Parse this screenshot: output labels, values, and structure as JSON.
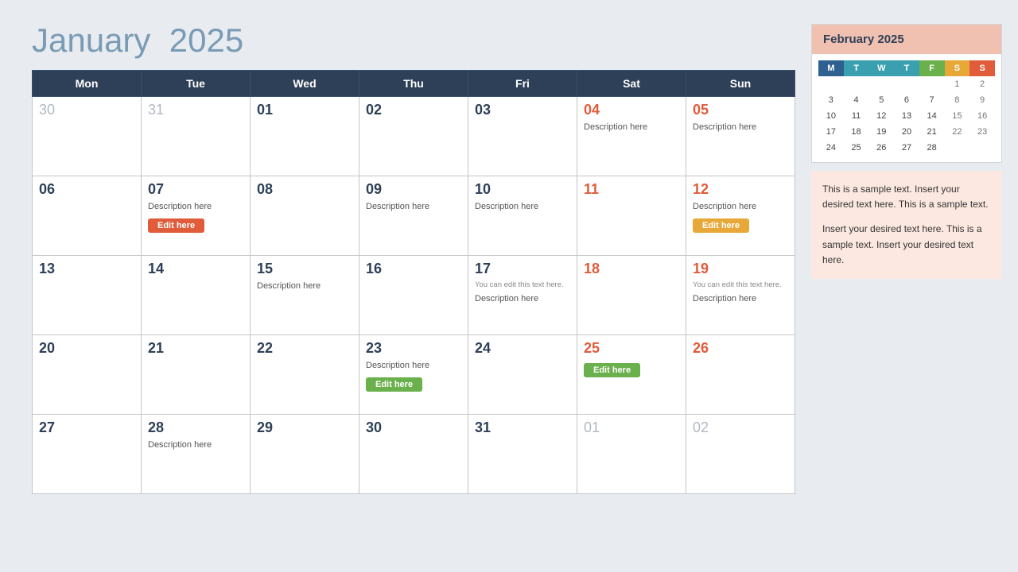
{
  "header": {
    "month": "January",
    "year": "2025"
  },
  "weekdays": [
    "Mon",
    "Tue",
    "Wed",
    "Thu",
    "Fri",
    "Sat",
    "Sun"
  ],
  "weeks": [
    [
      {
        "num": "30",
        "type": "other-month",
        "desc": "",
        "btn": null
      },
      {
        "num": "31",
        "type": "other-month",
        "desc": "",
        "btn": null
      },
      {
        "num": "01",
        "type": "normal",
        "desc": "",
        "btn": null
      },
      {
        "num": "02",
        "type": "normal",
        "desc": "",
        "btn": null
      },
      {
        "num": "03",
        "type": "normal",
        "desc": "",
        "btn": null
      },
      {
        "num": "04",
        "type": "weekend",
        "desc": "Description here",
        "btn": null
      },
      {
        "num": "05",
        "type": "weekend",
        "desc": "Description here",
        "btn": null
      }
    ],
    [
      {
        "num": "06",
        "type": "normal",
        "desc": "",
        "btn": null
      },
      {
        "num": "07",
        "type": "normal",
        "desc": "Description here",
        "btn": {
          "label": "Edit here",
          "color": "red"
        }
      },
      {
        "num": "08",
        "type": "normal",
        "desc": "",
        "btn": null
      },
      {
        "num": "09",
        "type": "normal",
        "desc": "Description here",
        "btn": null
      },
      {
        "num": "10",
        "type": "normal",
        "desc": "Description here",
        "btn": null
      },
      {
        "num": "11",
        "type": "weekend",
        "desc": "",
        "btn": null
      },
      {
        "num": "12",
        "type": "weekend",
        "desc": "Description here",
        "btn": {
          "label": "Edit here",
          "color": "orange"
        }
      }
    ],
    [
      {
        "num": "13",
        "type": "normal",
        "desc": "",
        "btn": null
      },
      {
        "num": "14",
        "type": "normal",
        "desc": "",
        "btn": null
      },
      {
        "num": "15",
        "type": "normal",
        "desc": "Description here",
        "btn": null
      },
      {
        "num": "16",
        "type": "normal",
        "desc": "",
        "btn": null
      },
      {
        "num": "17",
        "type": "normal",
        "desc": "Description here",
        "smallNote": "You can edit this text here.",
        "btn": null
      },
      {
        "num": "18",
        "type": "weekend",
        "desc": "",
        "btn": null
      },
      {
        "num": "19",
        "type": "weekend",
        "desc": "Description here",
        "smallNote": "You can edit this text here.",
        "btn": null
      }
    ],
    [
      {
        "num": "20",
        "type": "normal",
        "desc": "",
        "btn": null
      },
      {
        "num": "21",
        "type": "normal",
        "desc": "",
        "btn": null
      },
      {
        "num": "22",
        "type": "normal",
        "desc": "",
        "btn": null
      },
      {
        "num": "23",
        "type": "normal",
        "desc": "Description here",
        "btn": {
          "label": "Edit here",
          "color": "green"
        }
      },
      {
        "num": "24",
        "type": "normal",
        "desc": "",
        "btn": null
      },
      {
        "num": "25",
        "type": "weekend",
        "desc": "",
        "btn": {
          "label": "Edit here",
          "color": "green"
        }
      },
      {
        "num": "26",
        "type": "weekend",
        "desc": "",
        "btn": null
      }
    ],
    [
      {
        "num": "27",
        "type": "normal",
        "desc": "",
        "btn": null
      },
      {
        "num": "28",
        "type": "normal",
        "desc": "Description here",
        "btn": null
      },
      {
        "num": "29",
        "type": "normal",
        "desc": "",
        "btn": null
      },
      {
        "num": "30",
        "type": "normal",
        "desc": "",
        "btn": null
      },
      {
        "num": "31",
        "type": "normal",
        "desc": "",
        "btn": null
      },
      {
        "num": "01",
        "type": "other-month",
        "desc": "",
        "btn": null
      },
      {
        "num": "02",
        "type": "other-month",
        "desc": "",
        "btn": null
      }
    ]
  ],
  "mini_cal": {
    "title": "February 2025",
    "headers": [
      "M",
      "T",
      "W",
      "T",
      "F",
      "S",
      "S"
    ],
    "header_colors": [
      "blue",
      "teal",
      "teal",
      "teal",
      "green",
      "orange",
      "red"
    ],
    "weeks": [
      [
        "",
        "",
        "",
        "",
        "",
        "1",
        "2"
      ],
      [
        "3",
        "4",
        "5",
        "6",
        "7",
        "8",
        "9"
      ],
      [
        "10",
        "11",
        "12",
        "13",
        "14",
        "15",
        "16"
      ],
      [
        "17",
        "18",
        "19",
        "20",
        "21",
        "22",
        "23"
      ],
      [
        "24",
        "25",
        "26",
        "27",
        "28",
        "",
        ""
      ]
    ]
  },
  "sidebar_text1": "This is a sample text. Insert your desired text here. This is a sample text.",
  "sidebar_text2": "Insert your desired text here. This is a sample text. Insert your desired text here."
}
